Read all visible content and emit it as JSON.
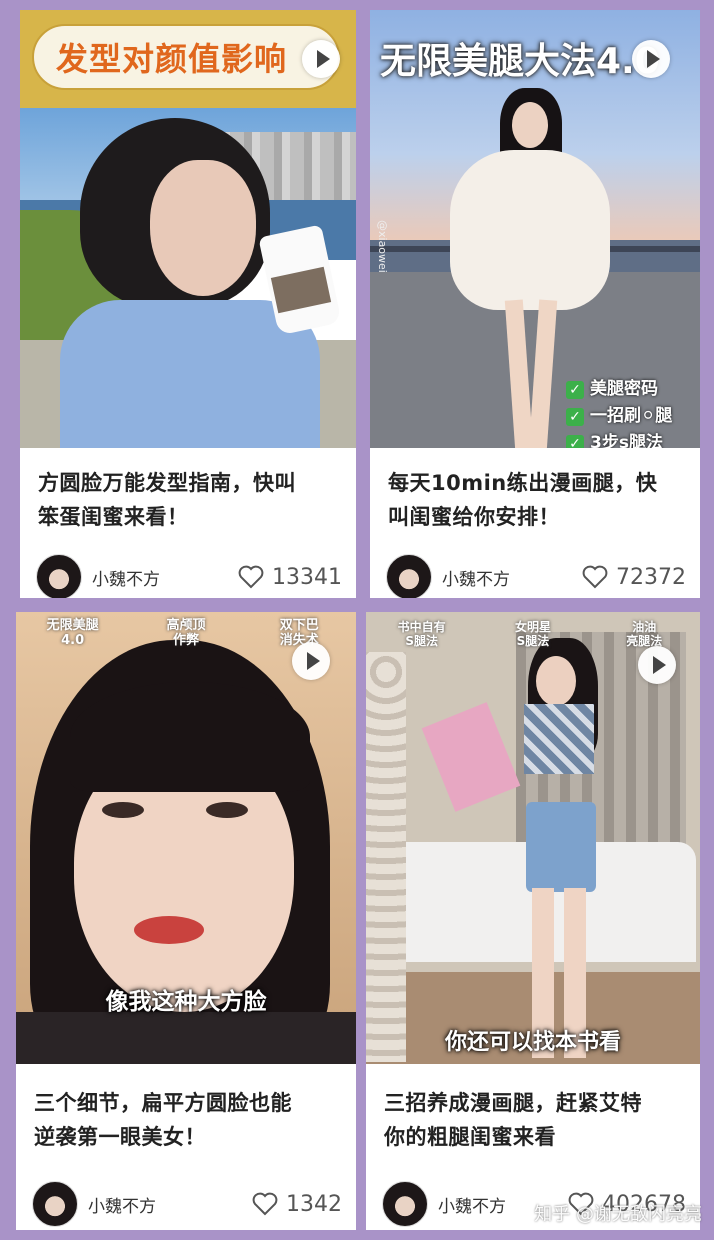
{
  "cards": [
    {
      "thumbnail_text": "发型对颜值影响",
      "title_line1": "方圆脸万能发型指南，快叫",
      "title_line2": "笨蛋闺蜜来看！",
      "author": "小魏不方",
      "likes": "13341"
    },
    {
      "thumbnail_text": "无限美腿大法4.0",
      "watermark": "@xiaowei",
      "checklist": [
        "美腿密码",
        "一招刷⚪腿",
        "3步s腿法"
      ],
      "title_line1": "每天10min练出漫画腿，快",
      "title_line2": "叫闺蜜给你安排！",
      "author": "小魏不方",
      "likes": "72372"
    },
    {
      "top_labels": [
        {
          "l1": "无限美腿",
          "l2": "4.0"
        },
        {
          "l1": "高颅顶",
          "l2": "作弊"
        },
        {
          "l1": "双下巴",
          "l2": "消失术"
        }
      ],
      "caption": "像我这种大方脸",
      "title_line1": "三个细节，扁平方圆脸也能",
      "title_line2": "逆袭第一眼美女！",
      "author": "小魏不方",
      "likes": "1342"
    },
    {
      "top_labels": [
        {
          "l1": "书中自有",
          "l2": "S腿法"
        },
        {
          "l1": "女明星",
          "l2": "S腿法"
        },
        {
          "l1": "油油",
          "l2": "亮腿法"
        }
      ],
      "caption": "你还可以找本书看",
      "title_line1": "三招养成漫画腿，赶紧艾特",
      "title_line2": "你的粗腿闺蜜来看",
      "author": "小魏不方",
      "likes": "402678"
    }
  ],
  "watermark": "知乎 @谢无敌闪亮亮",
  "icons": {
    "play": "play-icon",
    "like": "heart-outline-icon",
    "check": "check-box-icon"
  },
  "colors": {
    "background": "#a993c8",
    "card": "#ffffff"
  }
}
